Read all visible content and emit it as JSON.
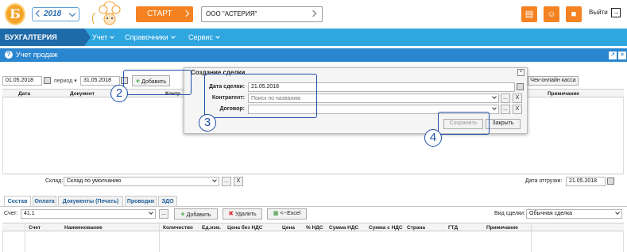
{
  "topbar": {
    "logo_letter": "Б",
    "year": "2018",
    "start_label": "СТАРТ",
    "org_name": "ООО \"АСТЕРИЯ\"",
    "logout_label": "Выйти",
    "icons": [
      "book-icon",
      "support-icon",
      "user-icon"
    ]
  },
  "nav": {
    "brand": "БУХГАЛТЕРИЯ",
    "items": [
      "Учет",
      "Справочники",
      "Сервис"
    ]
  },
  "page": {
    "title": "Учет продаж"
  },
  "filter": {
    "date_from": "01.05.2018",
    "period_label": "период",
    "date_to": "31.05.2018",
    "add_label": "Добавить",
    "kassa_label": "Чек-онлайн касса"
  },
  "sales_table": {
    "columns": [
      "Дата",
      "Документ",
      "Контр",
      "Примечание"
    ]
  },
  "warehouse": {
    "label": "Склад:",
    "value": "Склад по умолчанию",
    "ellipsis": "...",
    "clear": "X",
    "ship_label": "Дата отгрузки:",
    "ship_date": "21.05.2018"
  },
  "tabs": [
    "Состав",
    "Оплата",
    "Документы (Печать)",
    "Проводки",
    "ЭДО"
  ],
  "items_toolbar": {
    "account_label": "Счет:",
    "account_value": "41.1",
    "ellipsis": "...",
    "add_label": "Добавить",
    "delete_label": "Удалить",
    "excel_label": "<--Excel",
    "deal_type_label": "Вид сделки:",
    "deal_type_value": "Обычная сделка"
  },
  "items_table": {
    "columns": [
      "Счет",
      "Наименование",
      "Количество",
      "Ед.изм.",
      "Цена без НДС",
      "Цена",
      "% НДС",
      "Сумма НДС",
      "Сумма с НДС",
      "Страна",
      "ГТД",
      "Примечание"
    ]
  },
  "dialog": {
    "title": "Создание сделки",
    "date_label": "Дата сделки:",
    "date_value": "21.05.2018",
    "counterparty_label": "Контрагент:",
    "counterparty_placeholder": "Поиск по названию",
    "contract_label": "Договор:",
    "contract_value": "",
    "ellipsis": "...",
    "clear": "X",
    "save_label": "Сохранить",
    "close_label": "Закрыть"
  },
  "annotations": [
    "2",
    "3",
    "4"
  ],
  "colors": {
    "orange": "#f58220",
    "nav_blue": "#2fa6e0",
    "brand_blue": "#1f6aa8",
    "title_blue": "#2a86d0",
    "annotation_blue": "#1f4fa8"
  }
}
